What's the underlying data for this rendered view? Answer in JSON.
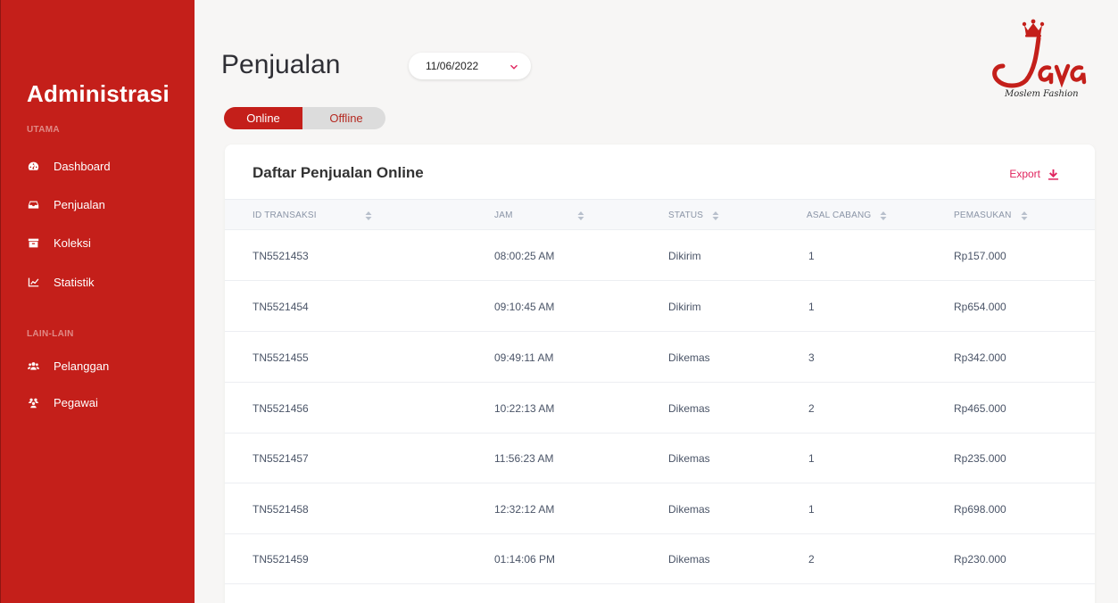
{
  "sidebar": {
    "brand": "Administrasi",
    "sections": [
      {
        "label": "UTAMA",
        "items": [
          {
            "label": "Dashboard",
            "icon": "dashboard-icon"
          },
          {
            "label": "Penjualan",
            "icon": "inbox-icon"
          },
          {
            "label": "Koleksi",
            "icon": "archive-icon"
          },
          {
            "label": "Statistik",
            "icon": "chart-line-icon"
          }
        ]
      },
      {
        "label": "LAIN-LAIN",
        "items": [
          {
            "label": "Pelanggan",
            "icon": "users-icon"
          },
          {
            "label": "Pegawai",
            "icon": "user-group-icon"
          }
        ]
      }
    ]
  },
  "header": {
    "title": "Penjualan",
    "date": "11/06/2022"
  },
  "logo": {
    "text": "Java",
    "tagline": "Moslem Fashion",
    "color": "#c41f1a"
  },
  "toggle": {
    "online": "Online",
    "offline": "Offline",
    "active": "Online"
  },
  "card": {
    "title": "Daftar Penjualan Online",
    "export_label": "Export"
  },
  "table": {
    "columns": [
      "ID TRANSAKSI",
      "JAM",
      "STATUS",
      "ASAL CABANG",
      "PEMASUKAN"
    ],
    "rows": [
      [
        "TN5521453",
        "08:00:25 AM",
        "Dikirim",
        "1",
        "Rp157.000"
      ],
      [
        "TN5521454",
        "09:10:45 AM",
        "Dikirim",
        "1",
        "Rp654.000"
      ],
      [
        "TN5521455",
        "09:49:11 AM",
        "Dikemas",
        "3",
        "Rp342.000"
      ],
      [
        "TN5521456",
        "10:22:13 AM",
        "Dikemas",
        "2",
        "Rp465.000"
      ],
      [
        "TN5521457",
        "11:56:23 AM",
        "Dikemas",
        "1",
        "Rp235.000"
      ],
      [
        "TN5521458",
        "12:32:12 AM",
        "Dikemas",
        "1",
        "Rp698.000"
      ],
      [
        "TN5521459",
        "01:14:06 PM",
        "Dikemas",
        "2",
        "Rp230.000"
      ]
    ]
  },
  "colors": {
    "sidebar": "#c41f1a",
    "accent": "#e0245e",
    "background": "#f7f6f5"
  }
}
